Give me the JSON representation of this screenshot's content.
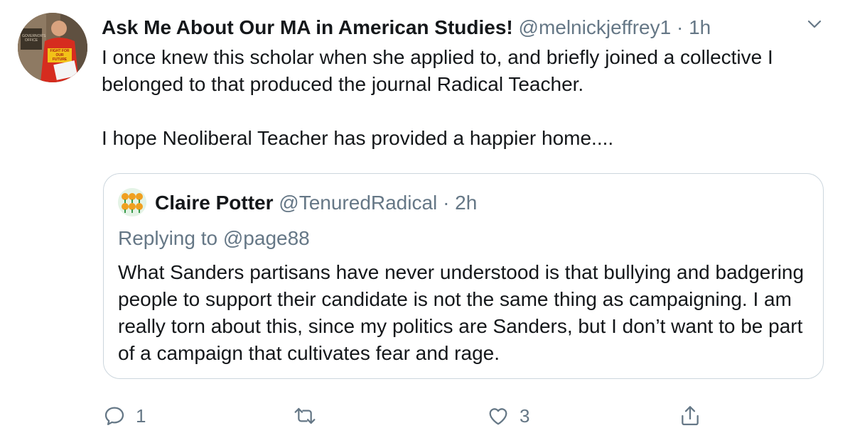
{
  "tweet": {
    "display_name": "Ask Me About Our MA in American Studies!",
    "handle": "@melnickjeffrey1",
    "separator": "·",
    "time": "1h",
    "avatar_sign_text": "GOVERNOR'S OFFICE",
    "avatar_shirt_text": "FIGHT FOR OUR FUTURE",
    "text_lines": [
      "I once knew this scholar when she applied to, and briefly joined a collective I belonged to that produced the journal Radical Teacher.",
      "I hope Neoliberal Teacher has provided a happier home...."
    ]
  },
  "quoted_tweet": {
    "display_name": "Claire Potter",
    "handle": "@TenuredRadical",
    "separator": "·",
    "time": "2h",
    "replying_prefix": "Replying to",
    "replying_to": "@page88",
    "text": "What Sanders partisans have never understood is that bullying and badgering people to support their candidate is not the same thing as campaigning. I am really torn about this, since my politics are Sanders, but I don’t want to be part of a campaign that cultivates fear and rage."
  },
  "actions": {
    "reply_count": "1",
    "retweet_count": "",
    "like_count": "3"
  },
  "icons": {
    "reply": "reply-icon",
    "retweet": "retweet-icon",
    "like": "heart-icon",
    "share": "share-icon",
    "menu": "chevron-down-icon"
  },
  "colors": {
    "text_primary": "#14171a",
    "text_secondary": "#657786",
    "border": "#ccd6dd"
  }
}
